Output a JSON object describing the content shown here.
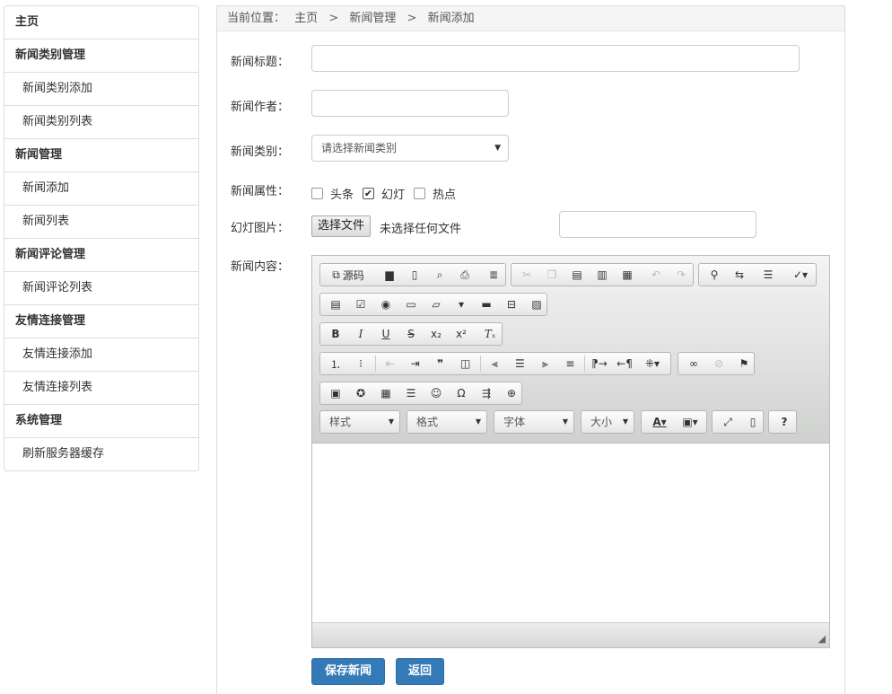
{
  "sidebar": {
    "items": [
      {
        "label": "主页",
        "type": "head"
      },
      {
        "label": "新闻类别管理",
        "type": "head"
      },
      {
        "label": "新闻类别添加",
        "type": "sub"
      },
      {
        "label": "新闻类别列表",
        "type": "sub"
      },
      {
        "label": "新闻管理",
        "type": "head"
      },
      {
        "label": "新闻添加",
        "type": "sub"
      },
      {
        "label": "新闻列表",
        "type": "sub"
      },
      {
        "label": "新闻评论管理",
        "type": "head"
      },
      {
        "label": "新闻评论列表",
        "type": "sub"
      },
      {
        "label": "友情连接管理",
        "type": "head"
      },
      {
        "label": "友情连接添加",
        "type": "sub"
      },
      {
        "label": "友情连接列表",
        "type": "sub"
      },
      {
        "label": "系统管理",
        "type": "head"
      },
      {
        "label": "刷新服务器缓存",
        "type": "sub"
      }
    ]
  },
  "breadcrumb": {
    "prefix": "当前位置：",
    "home": "主页",
    "section": "新闻管理",
    "current": "新闻添加",
    "separator": ">"
  },
  "form": {
    "title_label": "新闻标题：",
    "title_value": "",
    "author_label": "新闻作者：",
    "author_value": "",
    "category_label": "新闻类别：",
    "category_selected": "请选择新闻类别",
    "attr_label": "新闻属性：",
    "attrs": [
      {
        "label": "头条",
        "checked": false
      },
      {
        "label": "幻灯",
        "checked": true
      },
      {
        "label": "热点",
        "checked": false
      }
    ],
    "slide_label": "幻灯图片：",
    "file_button": "选择文件",
    "file_status": "未选择任何文件",
    "slide_input_value": "",
    "content_label": "新闻内容："
  },
  "editor": {
    "source_label": "源码",
    "combo_style": "样式",
    "combo_format": "格式",
    "combo_font": "字体",
    "combo_size": "大小"
  },
  "buttons": {
    "save": "保存新闻",
    "back": "返回"
  },
  "colors": {
    "primary": "#337ab7",
    "primary_border": "#2e6da4"
  }
}
